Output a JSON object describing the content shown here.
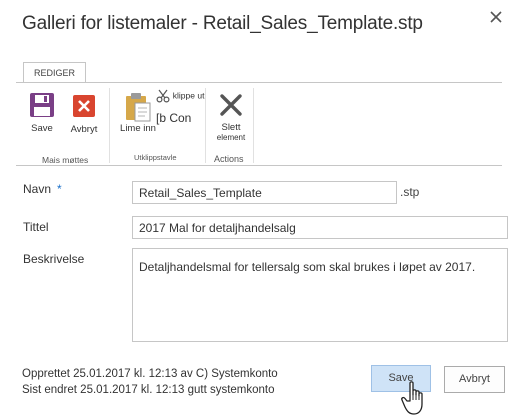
{
  "dialog": {
    "title": "Galleri for listemaler - Retail_Sales_Template.stp",
    "close_icon": "close-icon"
  },
  "ribbon": {
    "tab_label": "REDIGER",
    "groups": {
      "manage": {
        "label": "Mais møttes",
        "save_label": "Save",
        "cancel_label": "Avbryt"
      },
      "clipboard": {
        "label": "Utklippstavle",
        "paste_label": "Lime inn",
        "cut_label": "klippe ut",
        "copy_label": "[b Con"
      },
      "actions": {
        "label": "Actions",
        "delete_label_line1": "Slett",
        "delete_label_line2": "element"
      }
    }
  },
  "form": {
    "name": {
      "label": "Navn",
      "required_mark": "*",
      "value": "Retail_Sales_Template",
      "suffix": ".stp"
    },
    "title": {
      "label": "Tittel",
      "value": "2017 Mal for detaljhandelsalg"
    },
    "description": {
      "label": "Beskrivelse",
      "value": "Detaljhandelsmal for tellersalg som skal brukes i løpet av 2017."
    }
  },
  "meta": {
    "created": "Opprettet 25.01.2017 kl. 12:13 av C) Systemkonto",
    "modified": "Sist endret 25.01.2017 kl. 12:13 gutt systemkonto"
  },
  "buttons": {
    "save_label": "Save",
    "cancel_label": "Avbryt"
  },
  "colors": {
    "save_icon": "#7a3f86",
    "cancel_icon": "#d9452f",
    "primary_button": "#cfe3f7",
    "required": "#1a6fc9"
  }
}
